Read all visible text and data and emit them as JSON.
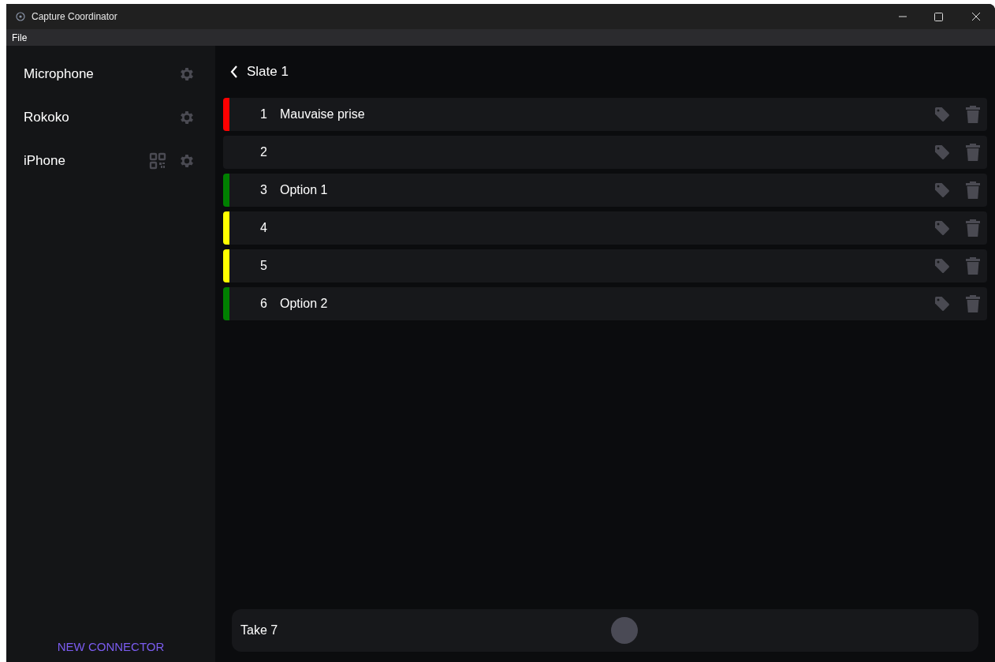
{
  "window": {
    "title": "Capture Coordinator"
  },
  "menu": [
    "File"
  ],
  "sidebar": {
    "connectors": [
      {
        "name": "Microphone",
        "qr": false
      },
      {
        "name": "Rokoko",
        "qr": false
      },
      {
        "name": "iPhone",
        "qr": true
      }
    ],
    "new_button": "NEW CONNECTOR"
  },
  "header": {
    "back": true,
    "title": "Slate 1"
  },
  "takes": [
    {
      "number": "1",
      "label": "Mauvaise prise",
      "color": "#ff0000"
    },
    {
      "number": "2"
    },
    {
      "number": "3",
      "label": "Option 1",
      "color": "#008000"
    },
    {
      "number": "4",
      "color": "#ffff00"
    },
    {
      "number": "5",
      "color": "#ffff00"
    },
    {
      "number": "6",
      "label": "Option 2",
      "color": "#008000"
    }
  ],
  "footer": {
    "take": "Take 7"
  }
}
